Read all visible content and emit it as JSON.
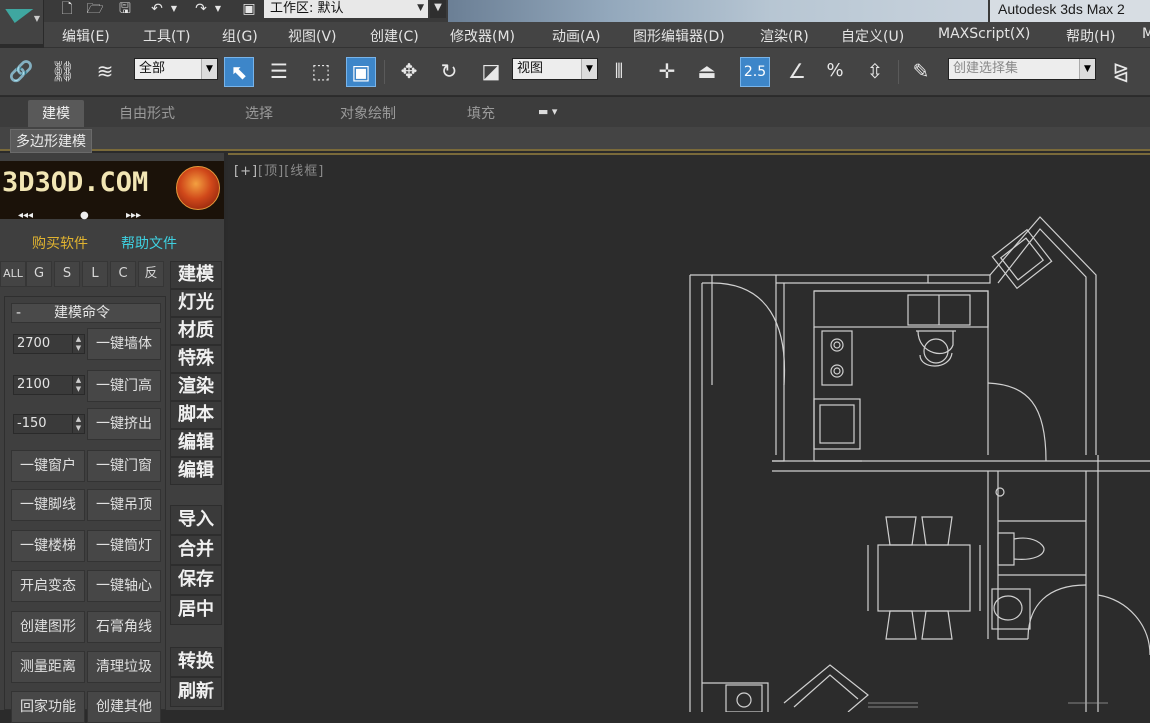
{
  "titlebar": {
    "workspace_label": "工作区: 默认",
    "app_title": "Autodesk 3ds Max  2"
  },
  "menu": [
    {
      "label": "编辑(E)"
    },
    {
      "label": "工具(T)"
    },
    {
      "label": "组(G)"
    },
    {
      "label": "视图(V)"
    },
    {
      "label": "创建(C)"
    },
    {
      "label": "修改器(M)"
    },
    {
      "label": "动画(A)"
    },
    {
      "label": "图形编辑器(D)"
    },
    {
      "label": "渲染(R)"
    },
    {
      "label": "自定义(U)"
    },
    {
      "label": "MAXScript(X)"
    },
    {
      "label": "帮助(H)"
    },
    {
      "label": "M"
    }
  ],
  "toolbar": {
    "selection_filter": "全部",
    "ref_coord": "视图",
    "snap_value": "2.5",
    "named_selection_placeholder": "创建选择集"
  },
  "ribbon": {
    "tabs": [
      {
        "label": "建模"
      },
      {
        "label": "自由形式"
      },
      {
        "label": "选择"
      },
      {
        "label": "对象绘制"
      },
      {
        "label": "填充"
      }
    ],
    "sub_label": "多边形建模"
  },
  "plugin": {
    "banner_text": "3D3OD.COM",
    "buy_link": "购买软件",
    "help_link": "帮助文件",
    "filters": [
      {
        "label": "ALL"
      },
      {
        "label": "G"
      },
      {
        "label": "S"
      },
      {
        "label": "L"
      },
      {
        "label": "C"
      },
      {
        "label": "反"
      }
    ],
    "panel_title": "建模命令",
    "panel_toggle": "-",
    "spinners": [
      {
        "value": "2700",
        "button": "一键墙体"
      },
      {
        "value": "2100",
        "button": "一键门高"
      },
      {
        "value": "-150",
        "button": "一键挤出"
      }
    ],
    "buttons": [
      {
        "label": "一键窗户"
      },
      {
        "label": "一键门窗"
      },
      {
        "label": "一键脚线"
      },
      {
        "label": "一键吊顶"
      },
      {
        "label": "一键楼梯"
      },
      {
        "label": "一键筒灯"
      },
      {
        "label": "开启变态"
      },
      {
        "label": "一键轴心"
      },
      {
        "label": "创建图形"
      },
      {
        "label": "石膏角线"
      },
      {
        "label": "测量距离"
      },
      {
        "label": "清理垃圾"
      },
      {
        "label": "回家功能"
      },
      {
        "label": "创建其他"
      }
    ],
    "side_buttons_top": [
      {
        "label": "建模"
      },
      {
        "label": "灯光"
      },
      {
        "label": "材质"
      },
      {
        "label": "特殊"
      },
      {
        "label": "渲染"
      },
      {
        "label": "脚本"
      },
      {
        "label": "编辑"
      },
      {
        "label": "编辑"
      }
    ],
    "side_buttons_bottom": [
      {
        "label": "导入"
      },
      {
        "label": "合并"
      },
      {
        "label": "保存"
      },
      {
        "label": "居中"
      }
    ],
    "side_buttons_tail": [
      {
        "label": "转换"
      },
      {
        "label": "刷新"
      }
    ]
  },
  "viewport": {
    "label_plus": "[+]",
    "label_view": "[顶]",
    "label_shading": "[线框]"
  }
}
